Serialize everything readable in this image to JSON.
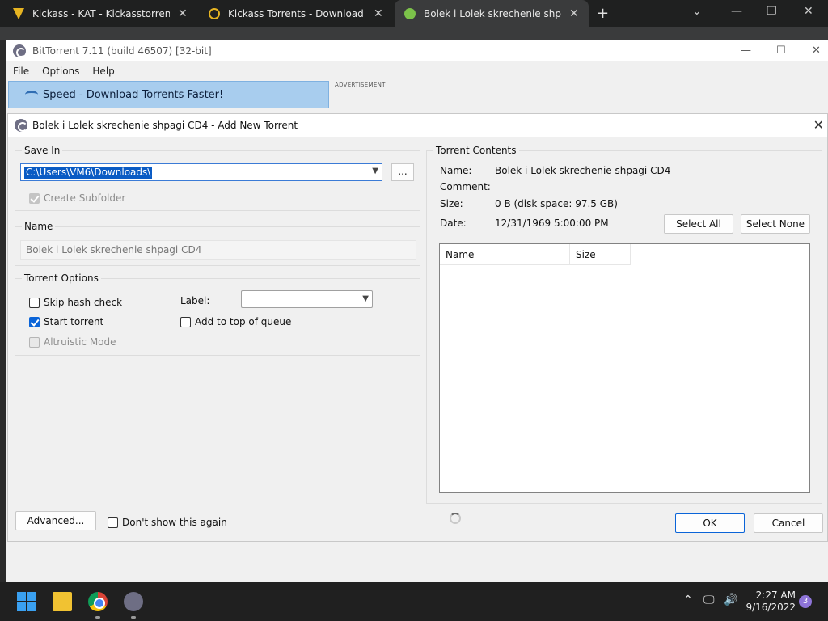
{
  "browser": {
    "tabs": [
      {
        "title": "Kickass - KAT - Kickasstorrents - ",
        "active": false
      },
      {
        "title": "Kickass Torrents - Download torre",
        "active": false
      },
      {
        "title": "Bolek i Lolek skrechenie shpagi C",
        "active": true
      }
    ],
    "new_tab": "+"
  },
  "bt": {
    "title": "BitTorrent 7.11  (build 46507) [32-bit]",
    "menu": [
      "File",
      "Options",
      "Help"
    ],
    "speed_banner": "Speed - Download Torrents Faster!",
    "advert_label": "ADVERTISEMENT"
  },
  "dialog": {
    "title": "Bolek i Lolek skrechenie shpagi CD4 - Add New Torrent",
    "save_in": {
      "label": "Save In",
      "path": "C:\\Users\\VM6\\Downloads\\",
      "browse": "...",
      "create_subfolder": "Create Subfolder"
    },
    "name": {
      "label": "Name",
      "value": "Bolek i Lolek skrechenie shpagi CD4"
    },
    "options": {
      "label": "Torrent Options",
      "skip_hash": "Skip hash check",
      "start_torrent": "Start torrent",
      "altruistic": "Altruistic Mode",
      "label_field": "Label:",
      "add_top": "Add to top of queue"
    },
    "contents": {
      "label": "Torrent Contents",
      "name_lbl": "Name:",
      "name_val": "Bolek i Lolek skrechenie shpagi CD4",
      "comment_lbl": "Comment:",
      "size_lbl": "Size:",
      "size_val": "0 B (disk space: 97.5 GB)",
      "date_lbl": "Date:",
      "date_val": "12/31/1969 5:00:00 PM",
      "select_all": "Select All",
      "select_none": "Select None",
      "columns": [
        "Name",
        "Size"
      ]
    },
    "advanced": "Advanced...",
    "dont_show": "Don't show this again",
    "ok": "OK",
    "cancel": "Cancel"
  },
  "taskbar": {
    "time": "2:27 AM",
    "date": "9/16/2022",
    "notifications": "3"
  }
}
